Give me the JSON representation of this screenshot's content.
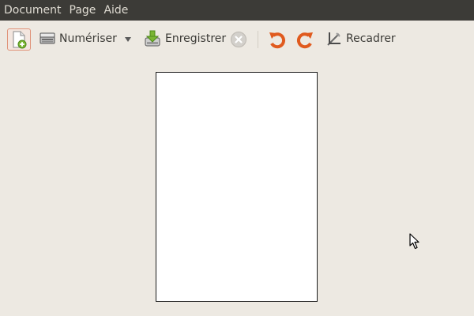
{
  "menubar": {
    "items": [
      {
        "label": "Document"
      },
      {
        "label": "Page"
      },
      {
        "label": "Aide"
      }
    ]
  },
  "toolbar": {
    "new_icon": "new-document-icon",
    "scan_label": "Numériser",
    "scan_icon": "scanner-icon",
    "scan_menu_icon": "dropdown-arrow-icon",
    "save_label": "Enregistrer",
    "save_icon": "save-disk-icon",
    "stop_icon": "stop-icon",
    "rotate_left_icon": "rotate-left-icon",
    "rotate_right_icon": "rotate-right-icon",
    "crop_label": "Recadrer",
    "crop_icon": "crop-icon"
  },
  "colors": {
    "background": "#EDE9E2",
    "menubar": "#3C3B37",
    "menu_text": "#DFDBD2",
    "accent": "#E05A1E"
  }
}
